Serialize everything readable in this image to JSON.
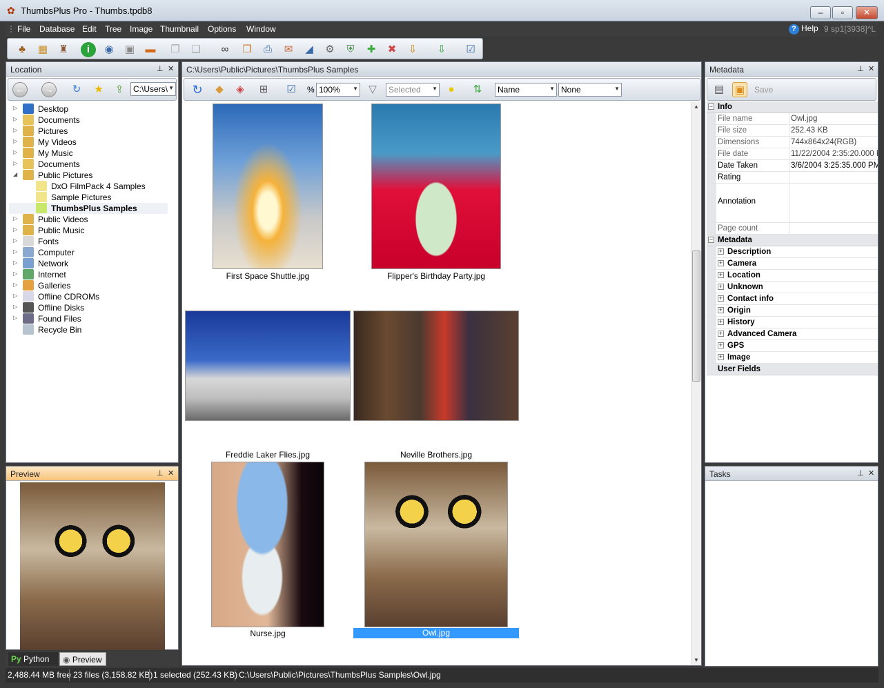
{
  "window": {
    "title": "ThumbsPlus Pro - Thumbs.tpdb8"
  },
  "menu": {
    "items": [
      "File",
      "Database",
      "Edit",
      "Tree",
      "Image",
      "Thumbnail",
      "Options",
      "Window"
    ],
    "help": "Help",
    "version": "9 sp1[3938]^L"
  },
  "location_pane": {
    "title": "Location",
    "path_combo": "C:\\Users\\",
    "tree": [
      {
        "label": "Desktop",
        "icon": "desktop-icon",
        "color": "#2f6fc8"
      },
      {
        "label": "Documents",
        "icon": "documents-folder-icon",
        "color": "#e8c25a"
      },
      {
        "label": "Pictures",
        "icon": "pictures-folder-icon",
        "color": "#e0b24a"
      },
      {
        "label": "My Videos",
        "icon": "videos-folder-icon",
        "color": "#e0b24a"
      },
      {
        "label": "My Music",
        "icon": "music-folder-icon",
        "color": "#e0b24a"
      },
      {
        "label": "Documents",
        "icon": "documents-folder-icon",
        "color": "#e8c25a"
      },
      {
        "label": "Public Pictures",
        "icon": "public-pictures-folder-icon",
        "color": "#e0b24a"
      },
      {
        "label": "DxO FilmPack 4 Samples",
        "icon": "folder-icon",
        "color": "#f2e48a"
      },
      {
        "label": "Sample Pictures",
        "icon": "folder-icon",
        "color": "#f2e48a"
      },
      {
        "label": "ThumbsPlus Samples",
        "icon": "folder-open-icon",
        "color": "#c9e86a"
      },
      {
        "label": "Public Videos",
        "icon": "videos-folder-icon",
        "color": "#e0b24a"
      },
      {
        "label": "Public Music",
        "icon": "music-folder-icon",
        "color": "#e0b24a"
      },
      {
        "label": "Fonts",
        "icon": "fonts-icon",
        "color": "#d9d9d9"
      },
      {
        "label": "Computer",
        "icon": "computer-icon",
        "color": "#8aa9cf"
      },
      {
        "label": "Network",
        "icon": "network-icon",
        "color": "#7aa0d2"
      },
      {
        "label": "Internet",
        "icon": "internet-icon",
        "color": "#5fa86a"
      },
      {
        "label": "Galleries",
        "icon": "galleries-icon",
        "color": "#e6a040"
      },
      {
        "label": "Offline CDROMs",
        "icon": "cdrom-icon",
        "color": "#d8d8e8"
      },
      {
        "label": "Offline Disks",
        "icon": "disk-icon",
        "color": "#555555"
      },
      {
        "label": "Found Files",
        "icon": "binoculars-icon",
        "color": "#6d6d8a"
      },
      {
        "label": "Recycle Bin",
        "icon": "recycle-bin-icon",
        "color": "#b7c3d0"
      }
    ]
  },
  "preview_pane": {
    "title": "Preview"
  },
  "bottom_tabs": [
    {
      "label": "Python"
    },
    {
      "label": "Preview"
    }
  ],
  "center_pane": {
    "path": "C:\\Users\\Public\\Pictures\\ThumbsPlus Samples",
    "zoom_label": "%",
    "zoom": "100%",
    "filter": "Selected",
    "sort1": "Name",
    "sort2": "None",
    "thumbnails": [
      {
        "caption": "First Space Shuttle.jpg",
        "selected": false
      },
      {
        "caption": "Flipper's Birthday Party.jpg",
        "selected": false
      },
      {
        "caption": "Freddie Laker Flies.jpg",
        "selected": false
      },
      {
        "caption": "Neville Brothers.jpg",
        "selected": false
      },
      {
        "caption": "Nurse.jpg",
        "selected": false
      },
      {
        "caption": "Owl.jpg",
        "selected": true
      }
    ]
  },
  "metadata_pane": {
    "title": "Metadata",
    "save_label": "Save",
    "info_header": "Info",
    "rows": [
      {
        "key": "File name",
        "value": "Owl.jpg"
      },
      {
        "key": "File size",
        "value": "252.43 KB"
      },
      {
        "key": "Dimensions",
        "value": "744x864x24(RGB)"
      },
      {
        "key": "File date",
        "value": "11/22/2004  2:35:20.000 P"
      },
      {
        "key": "Date Taken",
        "value": "3/6/2004  3:25:35.000 PM"
      },
      {
        "key": "Rating",
        "value": ""
      },
      {
        "key": "Annotation",
        "value": ""
      },
      {
        "key": "Page count",
        "value": ""
      }
    ],
    "metadata_header": "Metadata",
    "categories": [
      "Description",
      "Camera",
      "Location",
      "Unknown",
      "Contact info",
      "Origin",
      "History",
      "Advanced Camera",
      "GPS",
      "Image"
    ],
    "user_fields": "User Fields"
  },
  "tasks_pane": {
    "title": "Tasks"
  },
  "status": {
    "free": "2,488.44 MB free",
    "files": "23 files (3,158.82 KB)",
    "selected": "1 selected (252.43 KB)",
    "path": "C:\\Users\\Public\\Pictures\\ThumbsPlus Samples\\Owl.jpg"
  }
}
